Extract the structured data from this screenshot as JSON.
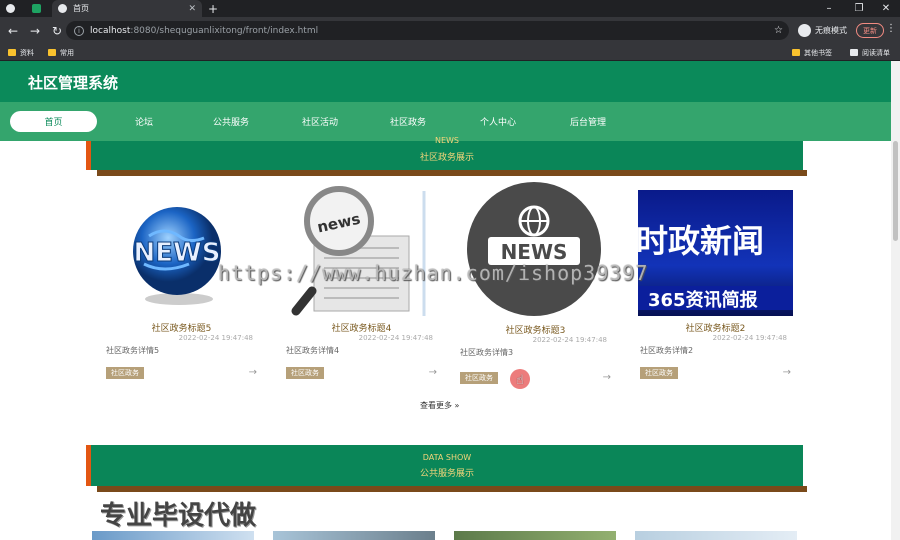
{
  "browser": {
    "tabs": [
      {
        "label": ""
      },
      {
        "label": ""
      },
      {
        "label": "首页"
      }
    ],
    "url_host": "localhost",
    "url_path": ":8080/shequguanlixitong/front/index.html",
    "incognito_label": "无痕模式",
    "update_label": "更新",
    "bookmarks": [
      "资料",
      "常用"
    ],
    "bookmarks_right": [
      "其他书签",
      "阅读清单"
    ]
  },
  "site": {
    "title": "社区管理系统",
    "nav": [
      "首页",
      "论坛",
      "公共服务",
      "社区活动",
      "社区政务",
      "个人中心",
      "后台管理"
    ]
  },
  "news_section": {
    "en": "NEWS",
    "cn": "社区政务展示"
  },
  "news_cards": [
    {
      "title": "社区政务标题5",
      "date": "2022-02-24 19:47:48",
      "desc": "社区政务详情5",
      "tag": "社区政务",
      "image": "globe-news-icon"
    },
    {
      "title": "社区政务标题4",
      "date": "2022-02-24 19:47:48",
      "desc": "社区政务详情4",
      "tag": "社区政务",
      "image": "magnifier-news-icon"
    },
    {
      "title": "社区政务标题3",
      "date": "2022-02-24 19:47:48",
      "desc": "社区政务详情3",
      "tag": "社区政务",
      "image": "news-circle-icon"
    },
    {
      "title": "社区政务标题2",
      "date": "2022-02-24 19:47:48",
      "desc": "社区政务详情2",
      "tag": "社区政务",
      "image": "shizheng-news-banner",
      "image_text_1": "时政新闻",
      "image_text_2": "365资讯简报"
    }
  ],
  "more_label": "查看更多",
  "data_section": {
    "en": "DATA SHOW",
    "cn": "公共服务展示"
  },
  "watermark": "https://www.huzhan.com/ishop39397",
  "overlay_text": "专业毕设代做",
  "colors": {
    "header": "#0b8a5a",
    "nav": "#34a56d",
    "accent": "#e35612",
    "tag": "#b6a079"
  }
}
